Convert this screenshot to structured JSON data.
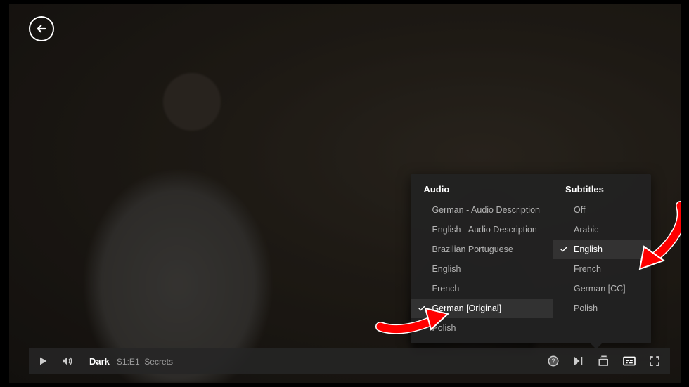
{
  "back_label": "Back",
  "control_bar": {
    "show_title": "Dark",
    "episode_label": "S1:E1",
    "episode_name": "Secrets"
  },
  "popup": {
    "audio": {
      "heading": "Audio",
      "options": [
        "German - Audio Description",
        "English - Audio Description",
        "Brazilian Portuguese",
        "English",
        "French",
        "German [Original]",
        "Polish"
      ],
      "selected_index": 5
    },
    "subtitles": {
      "heading": "Subtitles",
      "options": [
        "Off",
        "Arabic",
        "English",
        "French",
        "German [CC]",
        "Polish"
      ],
      "selected_index": 2
    }
  },
  "icons": {
    "play": "play-icon",
    "volume": "volume-icon",
    "help": "help-icon",
    "next": "next-episode-icon",
    "episodes": "episodes-icon",
    "subtitles": "subtitles-icon",
    "fullscreen": "fullscreen-icon"
  }
}
